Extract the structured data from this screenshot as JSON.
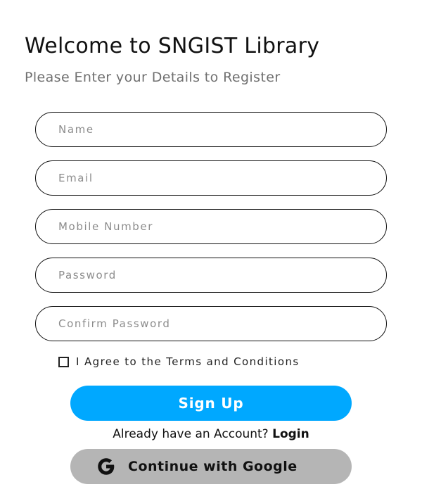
{
  "header": {
    "title": "Welcome to SNGIST Library",
    "subtitle": "Please Enter your Details to Register"
  },
  "form": {
    "fields": [
      {
        "id": "name",
        "placeholder": "Name",
        "value": ""
      },
      {
        "id": "email",
        "placeholder": "Email",
        "value": ""
      },
      {
        "id": "mobile",
        "placeholder": "Mobile Number",
        "value": ""
      },
      {
        "id": "password",
        "placeholder": "Password",
        "value": ""
      },
      {
        "id": "confirm_password",
        "placeholder": "Confirm Password",
        "value": ""
      }
    ],
    "agree": {
      "label": "I Agree to the Terms and Conditions",
      "checked": false
    },
    "signup_label": "Sign Up"
  },
  "login": {
    "prompt": "Already have an Account?",
    "link_label": "Login"
  },
  "google": {
    "label": "Continue with Google",
    "icon": "google-g-icon"
  },
  "colors": {
    "primary": "#00a8ff",
    "google_button": "#b5b5b5",
    "subtitle": "#707070",
    "placeholder": "#8c8c8c"
  }
}
